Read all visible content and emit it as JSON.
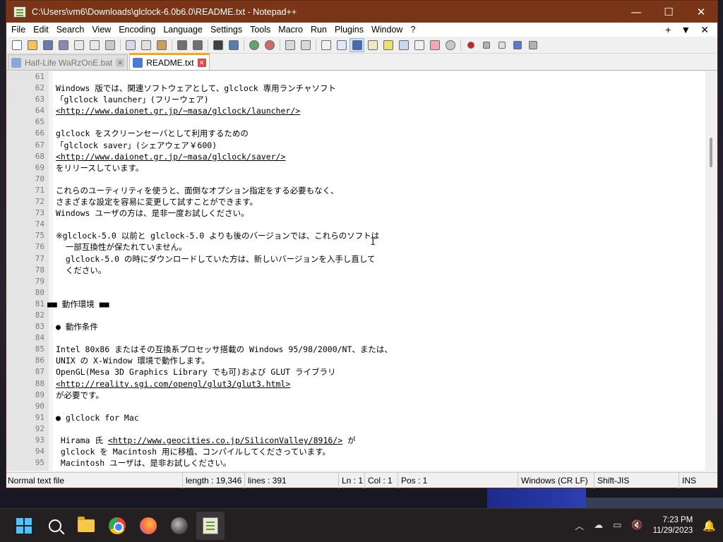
{
  "window": {
    "title": "C:\\Users\\vm6\\Downloads\\glclock-6.0b6.0\\README.txt - Notepad++",
    "controls": [
      "—",
      "☐",
      "✕"
    ]
  },
  "menu": {
    "items": [
      "File",
      "Edit",
      "Search",
      "View",
      "Encoding",
      "Language",
      "Settings",
      "Tools",
      "Macro",
      "Run",
      "Plugins",
      "Window",
      "?"
    ],
    "right": [
      "+",
      "▼",
      "✕"
    ]
  },
  "tabs": [
    {
      "label": "Half-Life WaRzOnE.bat",
      "active": false
    },
    {
      "label": "README.txt",
      "active": true
    }
  ],
  "editor": {
    "lines": [
      {
        "n": "61",
        "t": ""
      },
      {
        "n": "62",
        "t": "Windows 版では、関連ソフトウェアとして、glclock 専用ランチャソフト"
      },
      {
        "n": "63",
        "t": "「glclock launcher」(フリーウェア)"
      },
      {
        "n": "64",
        "t": "<http://www.daionet.gr.jp/~masa/glclock/launcher/>",
        "link": true
      },
      {
        "n": "65",
        "t": ""
      },
      {
        "n": "66",
        "t": "glclock をスクリーンセーバとして利用するための"
      },
      {
        "n": "67",
        "t": "「glclock saver」(シェアウェア￥600)"
      },
      {
        "n": "68",
        "t": "<http://www.daionet.gr.jp/~masa/glclock/saver/>",
        "link": true
      },
      {
        "n": "69",
        "t": "をリリースしています。"
      },
      {
        "n": "70",
        "t": ""
      },
      {
        "n": "71",
        "t": "これらのユーティリティを使うと、面倒なオプション指定をする必要もなく、"
      },
      {
        "n": "72",
        "t": "さまざまな設定を容易に変更して試すことができます。"
      },
      {
        "n": "73",
        "t": "Windows ユーザの方は、是非一度お試しください。"
      },
      {
        "n": "74",
        "t": ""
      },
      {
        "n": "75",
        "t": "※glclock-5.0 以前と glclock-5.0 よりも後のバージョンでは、これらのソフトは"
      },
      {
        "n": "76",
        "t": "  一部互換性が保たれていません。"
      },
      {
        "n": "77",
        "t": "  glclock-5.0 の時にダウンロードしていた方は、新しいバージョンを入手し直して"
      },
      {
        "n": "78",
        "t": "  ください。"
      },
      {
        "n": "79",
        "t": ""
      },
      {
        "n": "80",
        "t": ""
      },
      {
        "n": "81",
        "t": "■■ 動作環境 ■■",
        "outdent": true
      },
      {
        "n": "82",
        "t": ""
      },
      {
        "n": "83",
        "t": "● 動作条件"
      },
      {
        "n": "84",
        "t": ""
      },
      {
        "n": "85",
        "t": "Intel 80x86 またはその互換系プロセッサ搭載の Windows 95/98/2000/NT、または、"
      },
      {
        "n": "86",
        "t": "UNIX の X-Window 環境で動作します。"
      },
      {
        "n": "87",
        "t": "OpenGL(Mesa 3D Graphics Library でも可)および GLUT ライブラリ"
      },
      {
        "n": "88",
        "t": "<http://reality.sgi.com/opengl/glut3/glut3.html>",
        "link": true
      },
      {
        "n": "89",
        "t": "が必要です。"
      },
      {
        "n": "90",
        "t": ""
      },
      {
        "n": "91",
        "t": "● glclock for Mac"
      },
      {
        "n": "92",
        "t": ""
      },
      {
        "n": "93",
        "t": " Hirama 氏 <http://www.geocities.co.jp/SiliconValley/8916/> が",
        "partlink": true
      },
      {
        "n": "94",
        "t": " glclock を Macintosh 用に移植、コンパイルしてくださっています。"
      },
      {
        "n": "95",
        "t": " Macintosh ユーザは、是非お試しください。"
      }
    ]
  },
  "status": {
    "type": "Normal text file",
    "length": "length : 19,346",
    "lines": "lines : 391",
    "ln": "Ln : 1",
    "col": "Col : 1",
    "pos": "Pos : 1",
    "eol": "Windows (CR LF)",
    "encoding": "Shift-JIS",
    "mode": "INS"
  },
  "taskbar": {
    "time": "7:23 PM",
    "date": "11/29/2023"
  },
  "colors": {
    "titlebar": "#7a3416",
    "active_tab_accent": "#f5a623"
  }
}
